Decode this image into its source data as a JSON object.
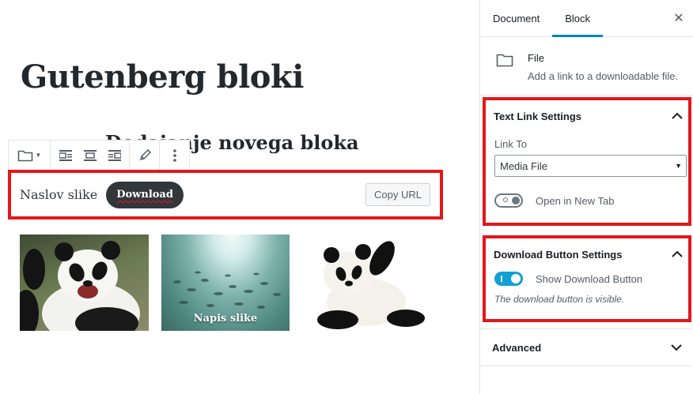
{
  "editor": {
    "post_title": "Gutenberg bloki",
    "heading": "Dodajanje novega bloka",
    "toolbar": {
      "icons": [
        "folder-icon",
        "align-left-icon",
        "align-center-icon",
        "align-right-icon",
        "pencil-icon",
        "more-vertical-icon"
      ]
    },
    "file_block": {
      "file_name": "Naslov slike",
      "download_label": "Download",
      "copy_url_label": "Copy URL"
    },
    "gallery": {
      "images": [
        {
          "alt": "panda-waving",
          "caption": ""
        },
        {
          "alt": "fish-underwater",
          "caption": "Napis slike"
        },
        {
          "alt": "panda-cub",
          "caption": ""
        }
      ]
    }
  },
  "sidebar": {
    "tabs": [
      {
        "label": "Document",
        "active": false
      },
      {
        "label": "Block",
        "active": true
      }
    ],
    "close_icon": "close-icon",
    "block_card": {
      "icon": "folder-icon",
      "title": "File",
      "description": "Add a link to a downloadable file."
    },
    "text_link_settings": {
      "title": "Text Link Settings",
      "link_to_label": "Link To",
      "link_to_value": "Media File",
      "new_tab_label": "Open in New Tab",
      "new_tab_enabled": false
    },
    "download_button_settings": {
      "title": "Download Button Settings",
      "show_label": "Show Download Button",
      "show_enabled": true,
      "help_text": "The download button is visible."
    },
    "advanced": {
      "title": "Advanced"
    }
  },
  "colors": {
    "highlight_red": "#e3171b",
    "accent_blue": "#0085ba",
    "toggle_on": "#11a0d2",
    "button_dark": "#32373c"
  }
}
